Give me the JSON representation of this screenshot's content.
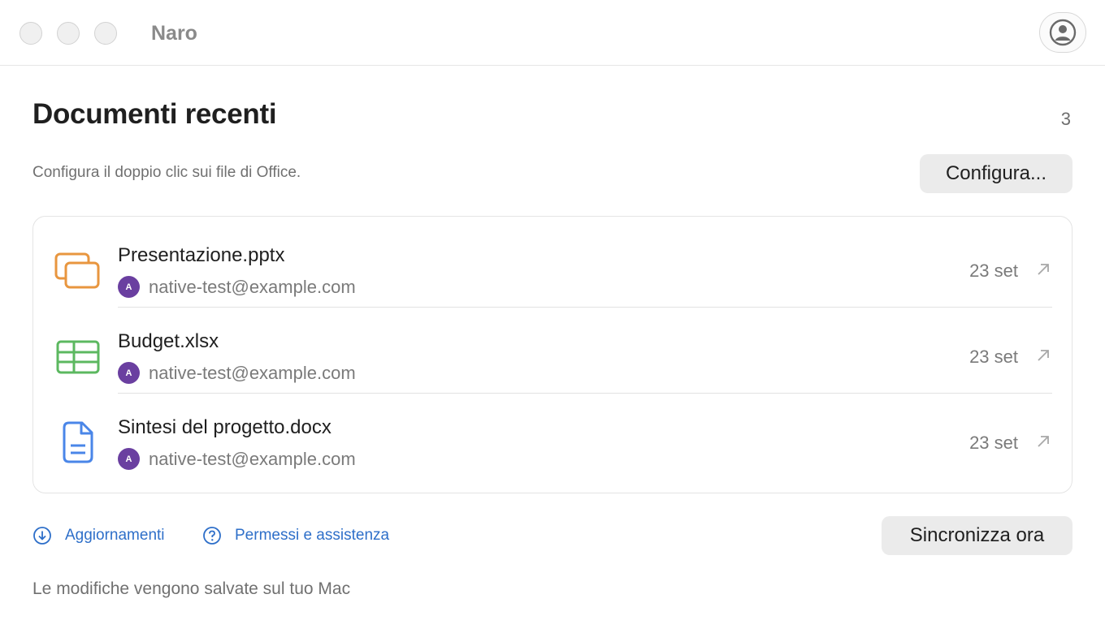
{
  "window": {
    "app_title": "Naro",
    "traffic_lights": [
      "close-button",
      "minimize-button",
      "zoom-button"
    ]
  },
  "header": {
    "title": "Documenti recenti",
    "count": "3",
    "subtitle": "Configura il doppio clic sui file di Office.",
    "configure_label": "Configura..."
  },
  "documents": [
    {
      "name": "Presentazione.pptx",
      "owner_initial": "A",
      "owner": "native-test@example.com",
      "date": "23 set",
      "icon": "presentation-icon",
      "color": "#e8963f"
    },
    {
      "name": "Budget.xlsx",
      "owner_initial": "A",
      "owner": "native-test@example.com",
      "date": "23 set",
      "icon": "spreadsheet-icon",
      "color": "#5cb860"
    },
    {
      "name": "Sintesi del progetto.docx",
      "owner_initial": "A",
      "owner": "native-test@example.com",
      "date": "23 set",
      "icon": "document-icon",
      "color": "#4a86e8"
    }
  ],
  "links": {
    "updates": "Aggiornamenti",
    "permissions": "Permessi e assistenza"
  },
  "sync_label": "Sincronizza ora",
  "footer_text": "Le modifiche vengono salvate sul tuo Mac",
  "colors": {
    "accent": "#2e6fc9",
    "owner_avatar": "#6a3fa0"
  }
}
